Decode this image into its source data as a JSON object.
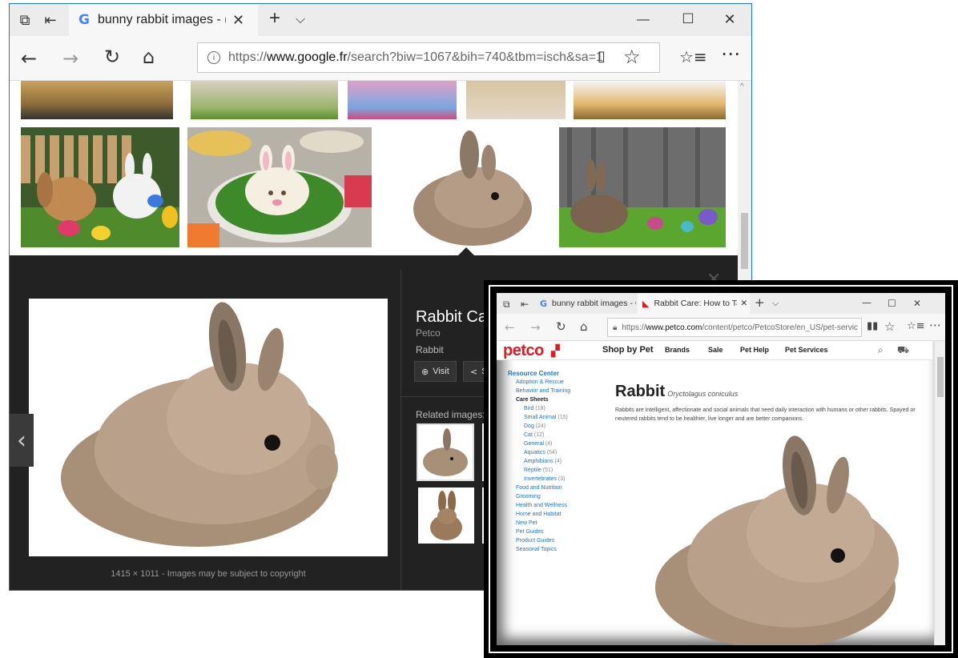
{
  "main_window": {
    "tab_title": "bunny rabbit images - (",
    "url_prefix": "https://",
    "url_host": "www.google.fr",
    "url_path": "/search?biw=1067&bih=740&tbm=isch&sa=1",
    "title_buttons": {
      "minimize": "—",
      "maximize": "☐",
      "close": "✕"
    },
    "new_tab": "+",
    "tab_list": "⌵",
    "image_viewer": {
      "title": "Rabbit Ca",
      "source": "Petco",
      "subtitle": "Rabbit",
      "visit_label": "Visit",
      "share_label": "S",
      "related_label": "Related images:",
      "dimensions": "1415 × 1011",
      "copyright_note": "- Images may be subject to copyright"
    }
  },
  "inset_window": {
    "tab1_title": "bunny rabbit images - Goo",
    "tab2_title": "Rabbit Care: How to Tal",
    "url_prefix": "https://",
    "url_host": "www.petco.com",
    "url_path": "/content/petco/PetcoStore/en_US/pet-servic",
    "site": {
      "logo": "petco",
      "nav": [
        "Shop by Pet",
        "Brands",
        "Sale",
        "Pet Help",
        "Pet Services"
      ],
      "sidebar": [
        {
          "label": "Resource Center",
          "count": ""
        },
        {
          "label": "Adoption & Rescue",
          "count": ""
        },
        {
          "label": "Behavior and Training",
          "count": ""
        },
        {
          "label": "Care Sheets",
          "count": ""
        },
        {
          "label": "Bird",
          "count": "(18)"
        },
        {
          "label": "Small Animal",
          "count": "(15)"
        },
        {
          "label": "Dog",
          "count": "(24)"
        },
        {
          "label": "Cat",
          "count": "(12)"
        },
        {
          "label": "General",
          "count": "(4)"
        },
        {
          "label": "Aquatics",
          "count": "(54)"
        },
        {
          "label": "Amphibians",
          "count": "(4)"
        },
        {
          "label": "Reptile",
          "count": "(51)"
        },
        {
          "label": "Invertebrates",
          "count": "(3)"
        },
        {
          "label": "Food and Nutrition",
          "count": ""
        },
        {
          "label": "Grooming",
          "count": ""
        },
        {
          "label": "Health and Wellness",
          "count": ""
        },
        {
          "label": "Home and Habitat",
          "count": ""
        },
        {
          "label": "New Pet",
          "count": ""
        },
        {
          "label": "Pet Guides",
          "count": ""
        },
        {
          "label": "Product Guides",
          "count": ""
        },
        {
          "label": "Seasonal Topics",
          "count": ""
        }
      ],
      "heading": "Rabbit",
      "latin_name": "Oryctolagus coniculus",
      "description": "Rabbits are intelligent, affectionate and social animals that need daily interaction with humans or other rabbits. Spayed or neutered rabbits tend to be healthier, live longer and are better companions."
    }
  },
  "colors": {
    "accent": "#1979ca",
    "petco_red": "#e11b22",
    "link_blue": "#1a75cf",
    "dark_panel": "#222222"
  }
}
